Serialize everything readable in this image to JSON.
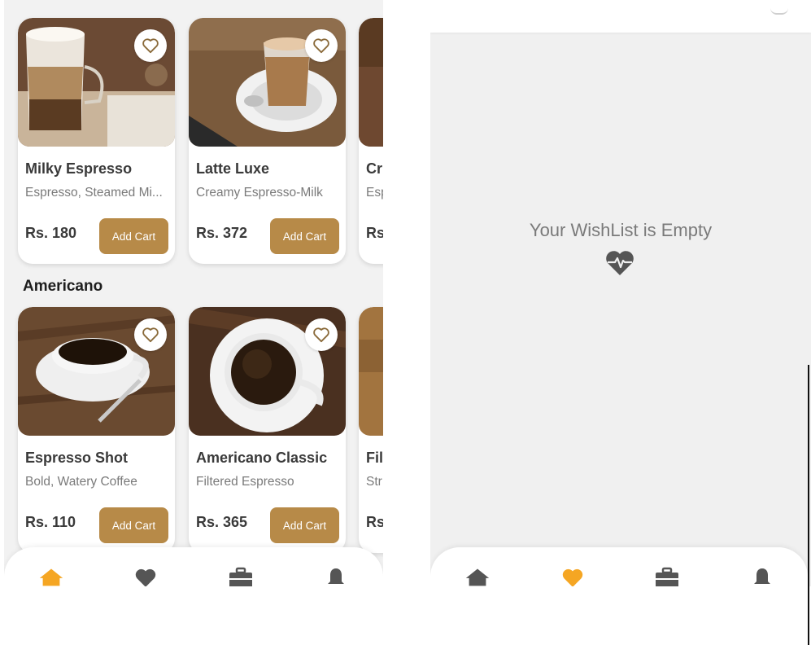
{
  "left_screen": {
    "cards_row1": [
      {
        "title": "Milky Espresso",
        "desc": "Espresso, Steamed Mi...",
        "price": "Rs. 180",
        "button": "Add Cart"
      },
      {
        "title": "Latte Luxe",
        "desc": "Creamy Espresso-Milk",
        "price": "Rs. 372",
        "button": "Add Cart"
      },
      {
        "title": "Cr",
        "desc": "Esp",
        "price": "Rs"
      }
    ],
    "section_title": "Americano",
    "cards_row2": [
      {
        "title": "Espresso Shot",
        "desc": "Bold, Watery Coffee",
        "price": "Rs. 110",
        "button": "Add Cart"
      },
      {
        "title": "Americano Classic",
        "desc": "Filtered Espresso",
        "price": "Rs. 365",
        "button": "Add Cart"
      },
      {
        "title": "Fil",
        "desc": "Str",
        "price": "Rs"
      }
    ],
    "nav": {
      "active": "home",
      "items": [
        "home-icon",
        "heart-icon",
        "briefcase-icon",
        "bell-icon"
      ]
    }
  },
  "right_screen": {
    "empty_message": "Your WishList is Empty",
    "empty_icon": "heartbeat-icon",
    "nav": {
      "active": "wishlist",
      "items": [
        "home-icon",
        "heart-icon",
        "briefcase-icon",
        "bell-icon"
      ]
    }
  },
  "colors": {
    "accent_orange": "#f5a623",
    "button_brown": "#b78a48",
    "icon_gray": "#555555",
    "heart_outline": "#8a6a3a"
  }
}
